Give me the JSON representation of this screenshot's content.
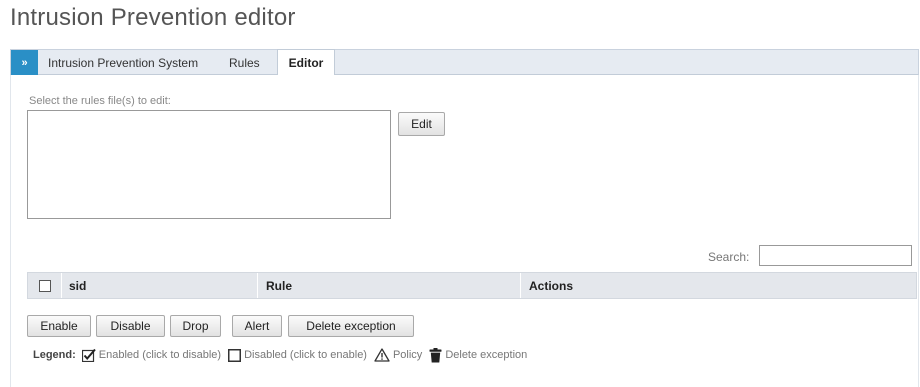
{
  "page": {
    "title": "Intrusion Prevention editor"
  },
  "tabs": {
    "toggle": "»",
    "crumbs": [
      "Intrusion Prevention System",
      "Rules"
    ],
    "active": "Editor"
  },
  "editor": {
    "select_label": "Select the rules file(s) to edit:",
    "edit_button": "Edit"
  },
  "search": {
    "label": "Search:",
    "value": ""
  },
  "table": {
    "columns": [
      "sid",
      "Rule",
      "Actions"
    ],
    "rows": []
  },
  "actions": {
    "enable": "Enable",
    "disable": "Disable",
    "drop": "Drop",
    "alert": "Alert",
    "delete_exception": "Delete exception"
  },
  "legend": {
    "label": "Legend:",
    "enabled": "Enabled (click to disable)",
    "disabled": "Disabled (click to enable)",
    "policy": "Policy",
    "delete_exception": "Delete exception"
  },
  "colors": {
    "accent": "#2a8fc6",
    "tabbar": "#e6ebf2",
    "table_header": "#e4e7ec"
  }
}
